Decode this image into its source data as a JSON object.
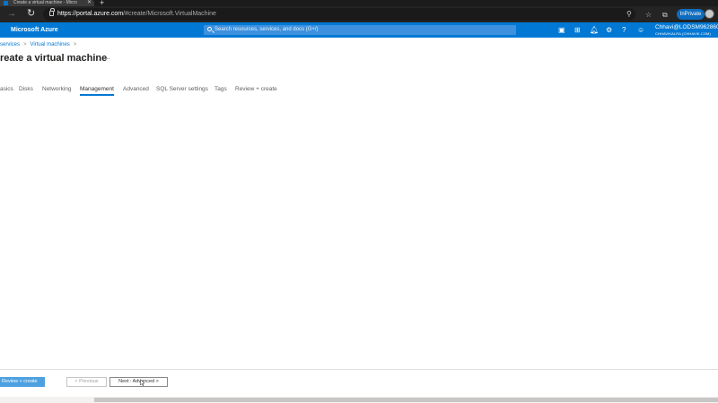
{
  "browser": {
    "tab_title": "Create a virtual machine - Micro",
    "tab_close": "✕",
    "new_tab": "+",
    "url_host": "https://portal.azure.com",
    "url_path": "/#create/Microsoft.VirtualMachine",
    "inprivate_label": "InPrivate"
  },
  "azure": {
    "brand": "Microsoft Azure",
    "search_placeholder": "Search resources, services, and docs (G+/)",
    "account_name": "Chhavi@LODSM962860....",
    "account_tenant": "CHHAVIKALRA (CHHAVIK.COM)"
  },
  "page": {
    "breadcrumb": [
      "services",
      "Virtual machines"
    ],
    "title": "reate a virtual machine",
    "more": "...",
    "tabs": [
      {
        "label": "asics",
        "active": false
      },
      {
        "label": "Disks",
        "active": false
      },
      {
        "label": "Networking",
        "active": false
      },
      {
        "label": "Management",
        "active": true
      },
      {
        "label": "Advanced",
        "active": false
      },
      {
        "label": "SQL Server settings",
        "active": false
      },
      {
        "label": "Tags",
        "active": false
      },
      {
        "label": "Review + create",
        "active": false
      }
    ]
  },
  "footer": {
    "review_create": "Review + create",
    "previous": "< Previous",
    "next": "Next : Advanced >"
  }
}
